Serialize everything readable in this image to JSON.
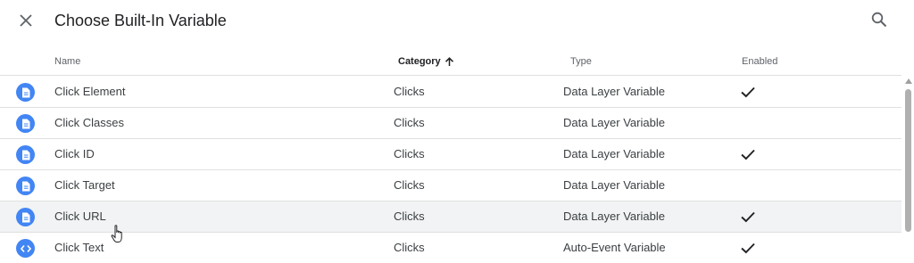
{
  "dialog": {
    "title": "Choose Built-In Variable",
    "close_icon": "close-icon",
    "search_icon": "search-icon"
  },
  "columns": {
    "name": "Name",
    "category": "Category",
    "type": "Type",
    "enabled": "Enabled",
    "sort_icon": "arrow-up-icon"
  },
  "rows": [
    {
      "name": "Click Element",
      "category": "Clicks",
      "type": "Data Layer Variable",
      "enabled": true,
      "icon": "document-icon"
    },
    {
      "name": "Click Classes",
      "category": "Clicks",
      "type": "Data Layer Variable",
      "enabled": false,
      "icon": "document-icon"
    },
    {
      "name": "Click ID",
      "category": "Clicks",
      "type": "Data Layer Variable",
      "enabled": true,
      "icon": "document-icon"
    },
    {
      "name": "Click Target",
      "category": "Clicks",
      "type": "Data Layer Variable",
      "enabled": false,
      "icon": "document-icon"
    },
    {
      "name": "Click URL",
      "category": "Clicks",
      "type": "Data Layer Variable",
      "enabled": true,
      "icon": "document-icon"
    },
    {
      "name": "Click Text",
      "category": "Clicks",
      "type": "Auto-Event Variable",
      "enabled": true,
      "icon": "code-icon"
    }
  ],
  "colors": {
    "accent": "#4285f4",
    "row_hover": "#f1f3f4"
  }
}
